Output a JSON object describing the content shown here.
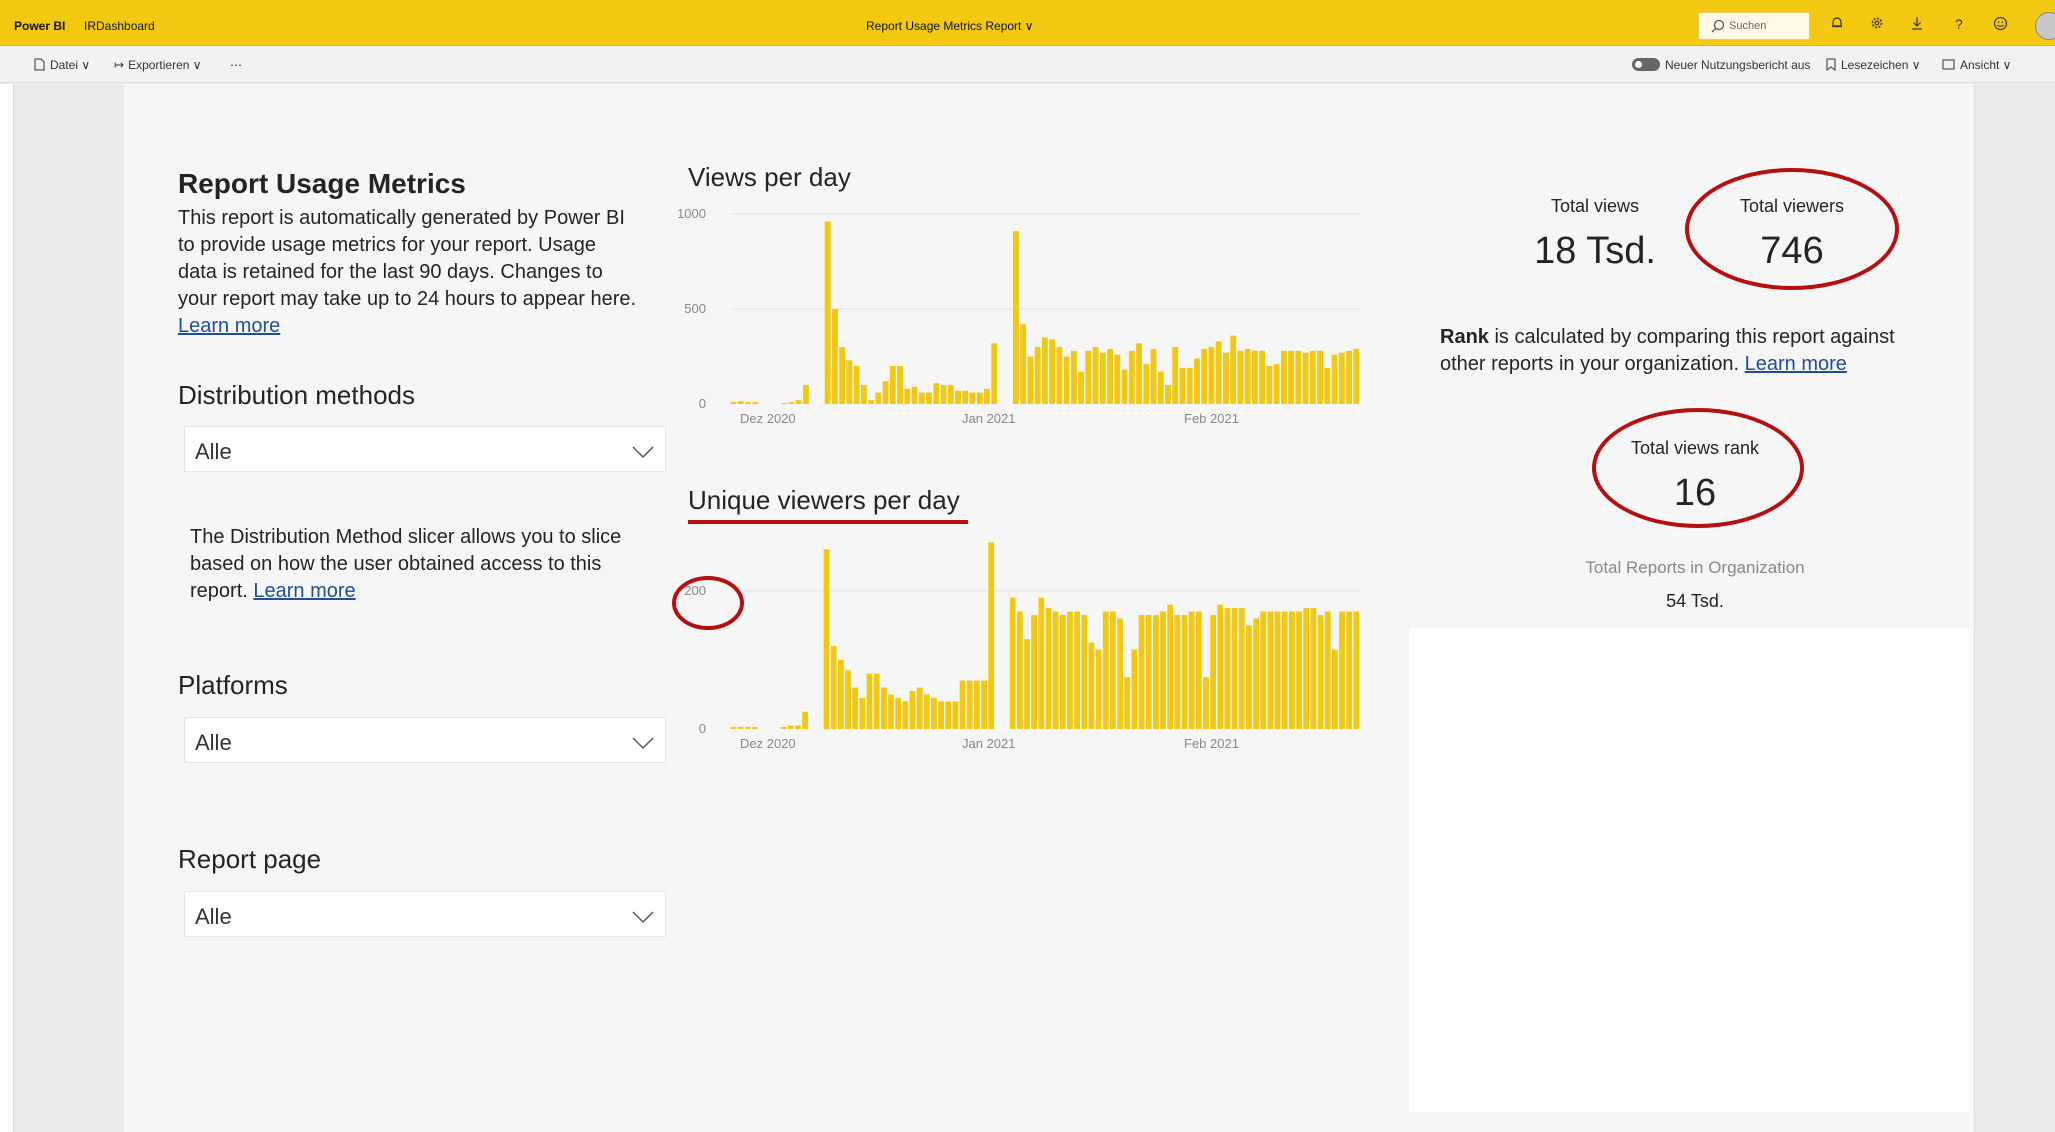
{
  "topbar": {
    "brand": "Power BI",
    "workspace": "IRDashboard",
    "report_title": "Report Usage Metrics Report ∨",
    "search_placeholder": "Suchen",
    "icons": [
      "bell-icon",
      "gear-icon",
      "download-icon",
      "help-icon",
      "smiley-icon",
      "avatar"
    ]
  },
  "toolbar": {
    "file": "Datei ∨",
    "export": "Exportieren ∨",
    "more": "⋯",
    "toggle_label": "Neuer Nutzungsbericht aus",
    "bookmarks": "Lesezeichen ∨",
    "view": "Ansicht ∨"
  },
  "intro": {
    "title": "Report Usage Metrics",
    "text": "This report is automatically generated by Power BI to provide usage metrics for your report. Usage data is retained for the last 90 days. Changes to your report may take up to 24 hours to appear here.",
    "link": "Learn more"
  },
  "slicers": {
    "distribution": {
      "label": "Distribution methods",
      "value": "Alle"
    },
    "distribution_help": "The Distribution Method slicer allows you to slice based on how the user obtained access to this report.",
    "distribution_link": "Learn more",
    "platforms": {
      "label": "Platforms",
      "value": "Alle"
    },
    "report_page": {
      "label": "Report page",
      "value": "Alle"
    }
  },
  "kpis": {
    "total_views_label": "Total views",
    "total_views_value": "18 Tsd.",
    "total_viewers_label": "Total viewers",
    "total_viewers_value": "746",
    "rank_bold": "Rank",
    "rank_text": " is calculated by comparing this report against other reports in your organization.",
    "rank_link": "Learn more",
    "rank_label": "Total views rank",
    "rank_value": "16",
    "total_reports_label": "Total Reports in Organization",
    "total_reports_value": "54 Tsd."
  },
  "colors": {
    "bar": "#f2c811",
    "annotation": "#b50f0f",
    "topbar": "#f2c811"
  },
  "chart_data": [
    {
      "type": "bar",
      "title": "Views per day",
      "ylim": [
        0,
        1000
      ],
      "yticks": [
        0,
        500,
        1000
      ],
      "xticks": [
        "Dez 2020",
        "Jan 2021",
        "Feb 2021"
      ],
      "values": [
        10,
        15,
        10,
        10,
        0,
        0,
        0,
        5,
        10,
        20,
        100,
        0,
        0,
        960,
        500,
        300,
        230,
        200,
        100,
        20,
        60,
        120,
        200,
        200,
        80,
        90,
        60,
        60,
        110,
        100,
        100,
        70,
        70,
        60,
        60,
        80,
        320,
        0,
        0,
        910,
        420,
        250,
        300,
        350,
        340,
        300,
        250,
        280,
        170,
        280,
        300,
        270,
        290,
        260,
        180,
        280,
        320,
        210,
        290,
        170,
        100,
        300,
        190,
        190,
        240,
        290,
        300,
        330,
        270,
        360,
        280,
        290,
        280,
        280,
        200,
        210,
        280,
        280,
        280,
        270,
        280,
        280,
        190,
        260,
        270,
        280,
        290
      ]
    },
    {
      "type": "bar",
      "title": "Unique viewers per day",
      "ylim": [
        0,
        275
      ],
      "yticks": [
        0,
        200
      ],
      "xticks": [
        "Dez 2020",
        "Jan 2021",
        "Feb 2021"
      ],
      "values": [
        3,
        3,
        3,
        3,
        0,
        0,
        0,
        3,
        5,
        5,
        25,
        0,
        0,
        260,
        120,
        100,
        85,
        60,
        45,
        80,
        80,
        60,
        50,
        45,
        40,
        55,
        60,
        50,
        45,
        40,
        40,
        40,
        70,
        70,
        70,
        70,
        270,
        0,
        0,
        190,
        170,
        130,
        165,
        190,
        175,
        170,
        165,
        170,
        170,
        165,
        125,
        115,
        170,
        170,
        160,
        75,
        115,
        165,
        165,
        165,
        170,
        180,
        165,
        165,
        170,
        170,
        75,
        165,
        180,
        175,
        175,
        175,
        150,
        160,
        170,
        170,
        170,
        170,
        170,
        170,
        175,
        175,
        165,
        170,
        115,
        170,
        170,
        170
      ]
    }
  ]
}
